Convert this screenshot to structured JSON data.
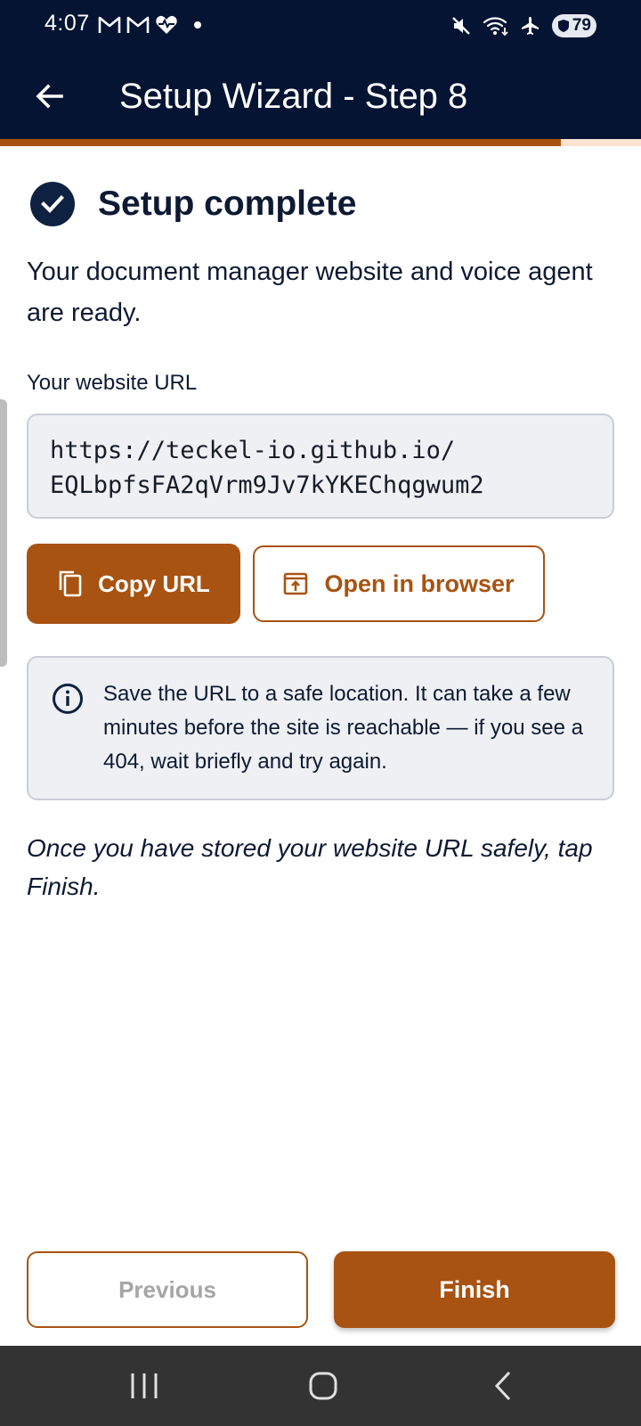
{
  "status_bar": {
    "time": "4:07",
    "left_icons": [
      "gmail-icon",
      "gmail-icon",
      "heart-rate-icon",
      "notification-dot-icon"
    ],
    "right_icons": [
      "mute-icon",
      "wifi-icon",
      "airplane-icon",
      "battery-icon"
    ],
    "battery_level": "79"
  },
  "app_bar": {
    "back_icon": "arrow-left-icon",
    "title": "Setup Wizard - Step 8"
  },
  "progress": {
    "fraction": 0.875,
    "fill_color": "#a85312",
    "track_color": "#fde3d2"
  },
  "content": {
    "headline": "Setup complete",
    "intro": "Your document manager website and voice agent are ready.",
    "url_label": "Your website URL",
    "url_line1": "https://teckel-io.github.io/",
    "url_line2": "EQLbpfsFA2qVrm9Jv7kYKEChqgwum2",
    "copy_button": "Copy URL",
    "open_button": "Open in browser",
    "info_text": "Save the URL to a safe location. It can take a few minutes before the site is reachable — if you see a 404, wait briefly and try again.",
    "finish_hint": "Once you have stored your website URL safely, tap Finish."
  },
  "actions": {
    "previous": "Previous",
    "finish": "Finish"
  },
  "colors": {
    "header_bg": "#051433",
    "accent": "#a85312",
    "card_bg": "#eef0f3",
    "text": "#0e1a33"
  }
}
